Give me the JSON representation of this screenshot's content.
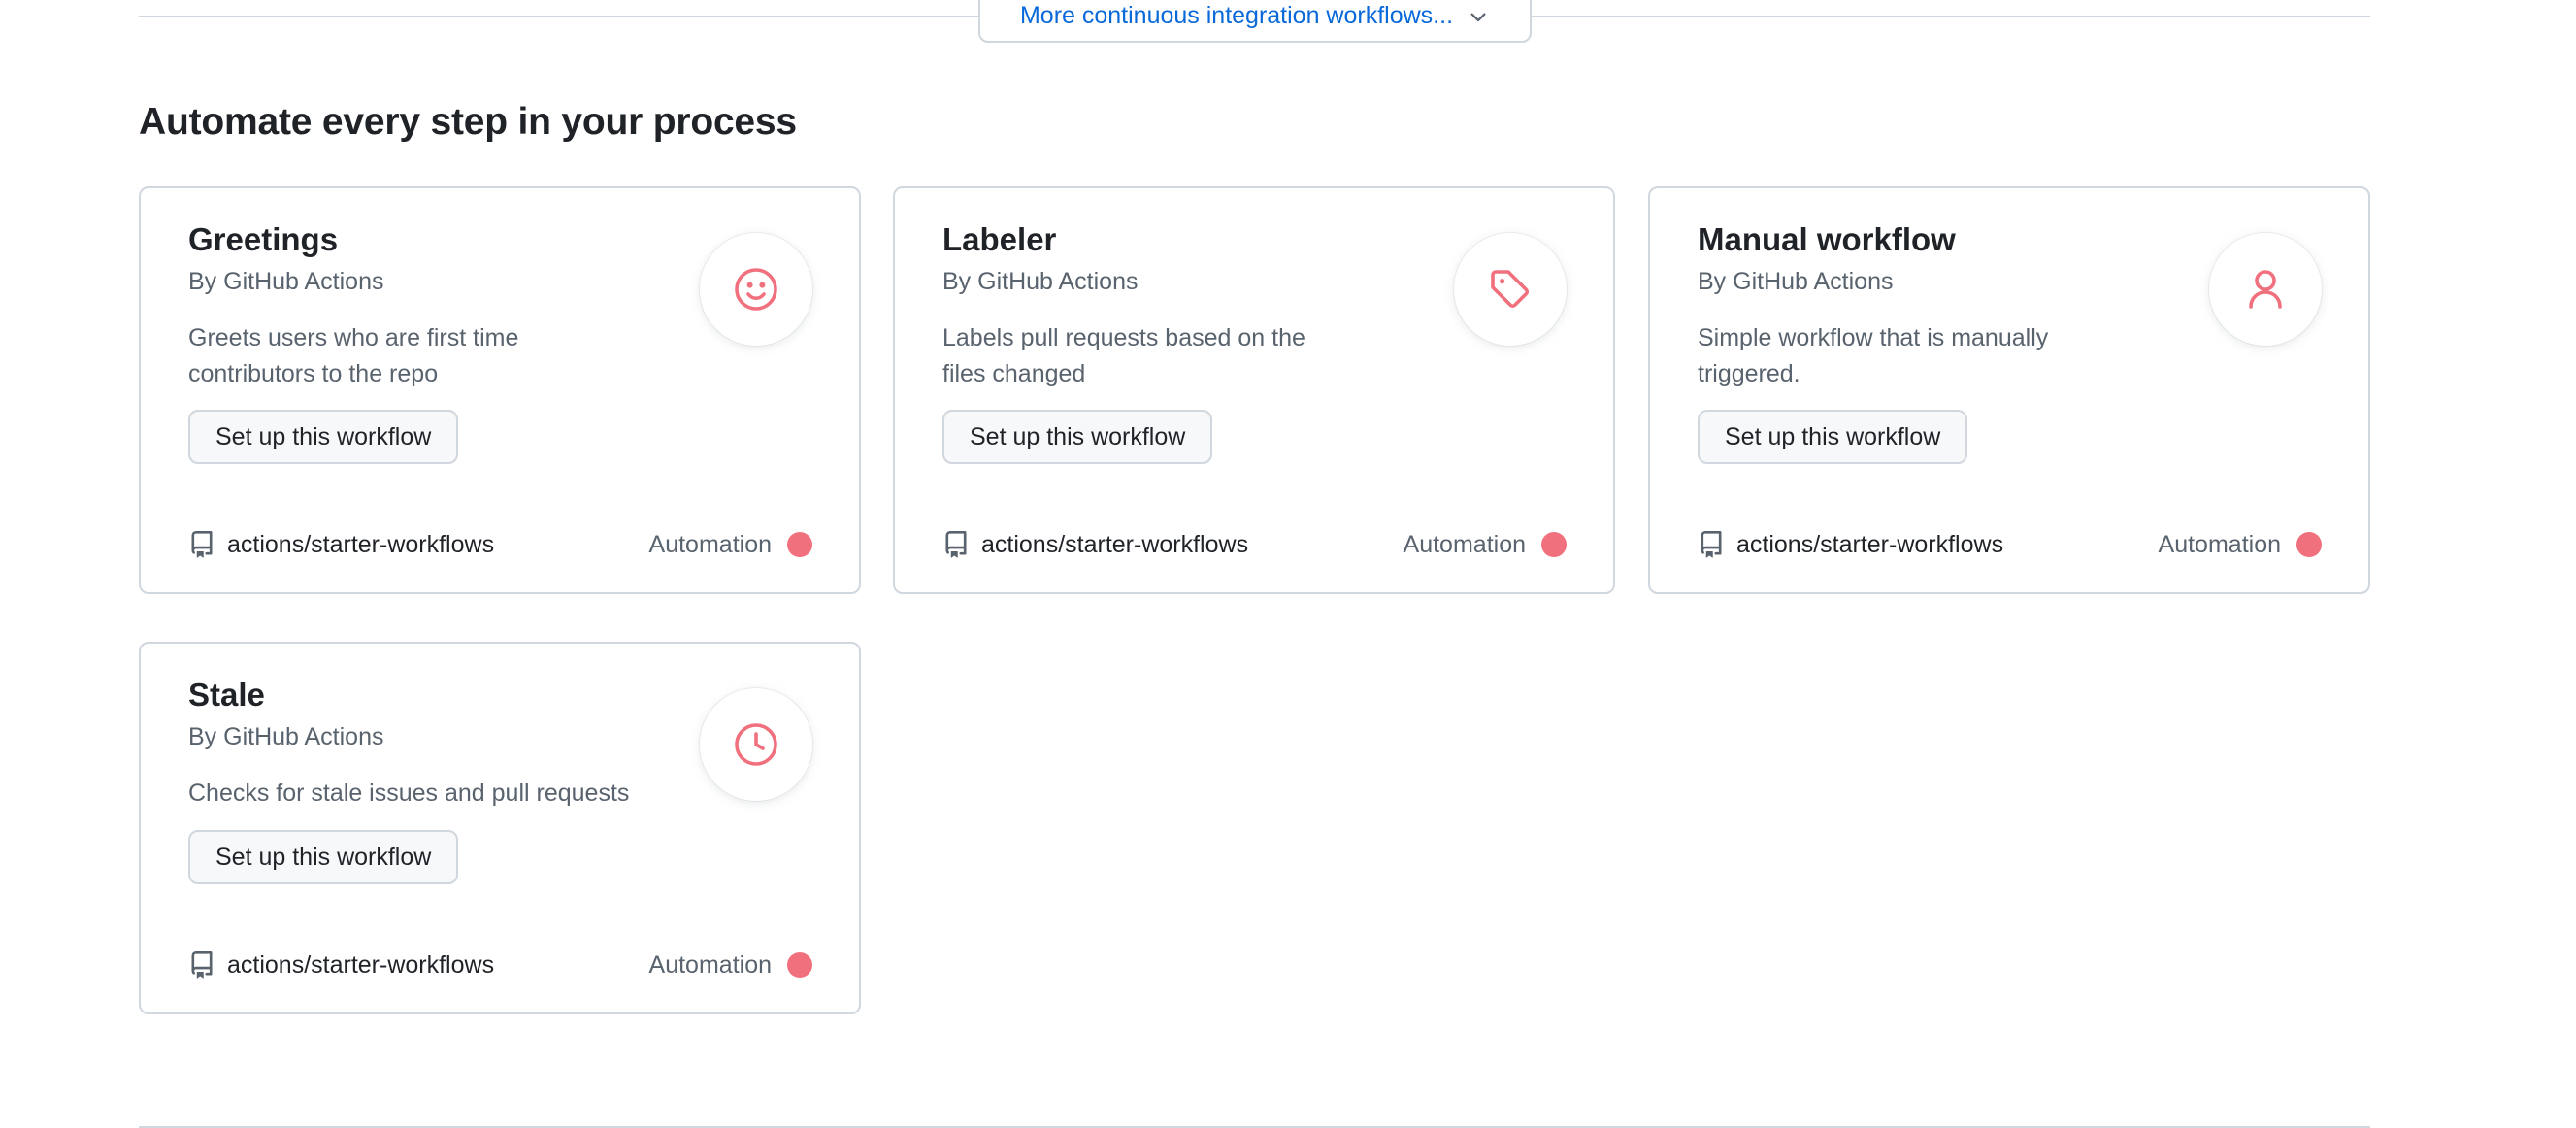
{
  "more_button": {
    "label": "More continuous integration workflows..."
  },
  "section": {
    "title": "Automate every step in your process"
  },
  "colors": {
    "accent": "#f0707d",
    "link": "#0969da"
  },
  "cards": [
    {
      "title": "Greetings",
      "author": "By GitHub Actions",
      "description": "Greets users who are first time contributors to the repo",
      "button": "Set up this workflow",
      "icon": "smiley-icon",
      "repo": "actions/starter-workflows",
      "category": "Automation"
    },
    {
      "title": "Labeler",
      "author": "By GitHub Actions",
      "description": "Labels pull requests based on the files changed",
      "button": "Set up this workflow",
      "icon": "tag-icon",
      "repo": "actions/starter-workflows",
      "category": "Automation"
    },
    {
      "title": "Manual workflow",
      "author": "By GitHub Actions",
      "description": "Simple workflow that is manually triggered.",
      "button": "Set up this workflow",
      "icon": "person-icon",
      "repo": "actions/starter-workflows",
      "category": "Automation"
    },
    {
      "title": "Stale",
      "author": "By GitHub Actions",
      "description": "Checks for stale issues and pull requests",
      "button": "Set up this workflow",
      "icon": "clock-icon",
      "repo": "actions/starter-workflows",
      "category": "Automation"
    }
  ]
}
